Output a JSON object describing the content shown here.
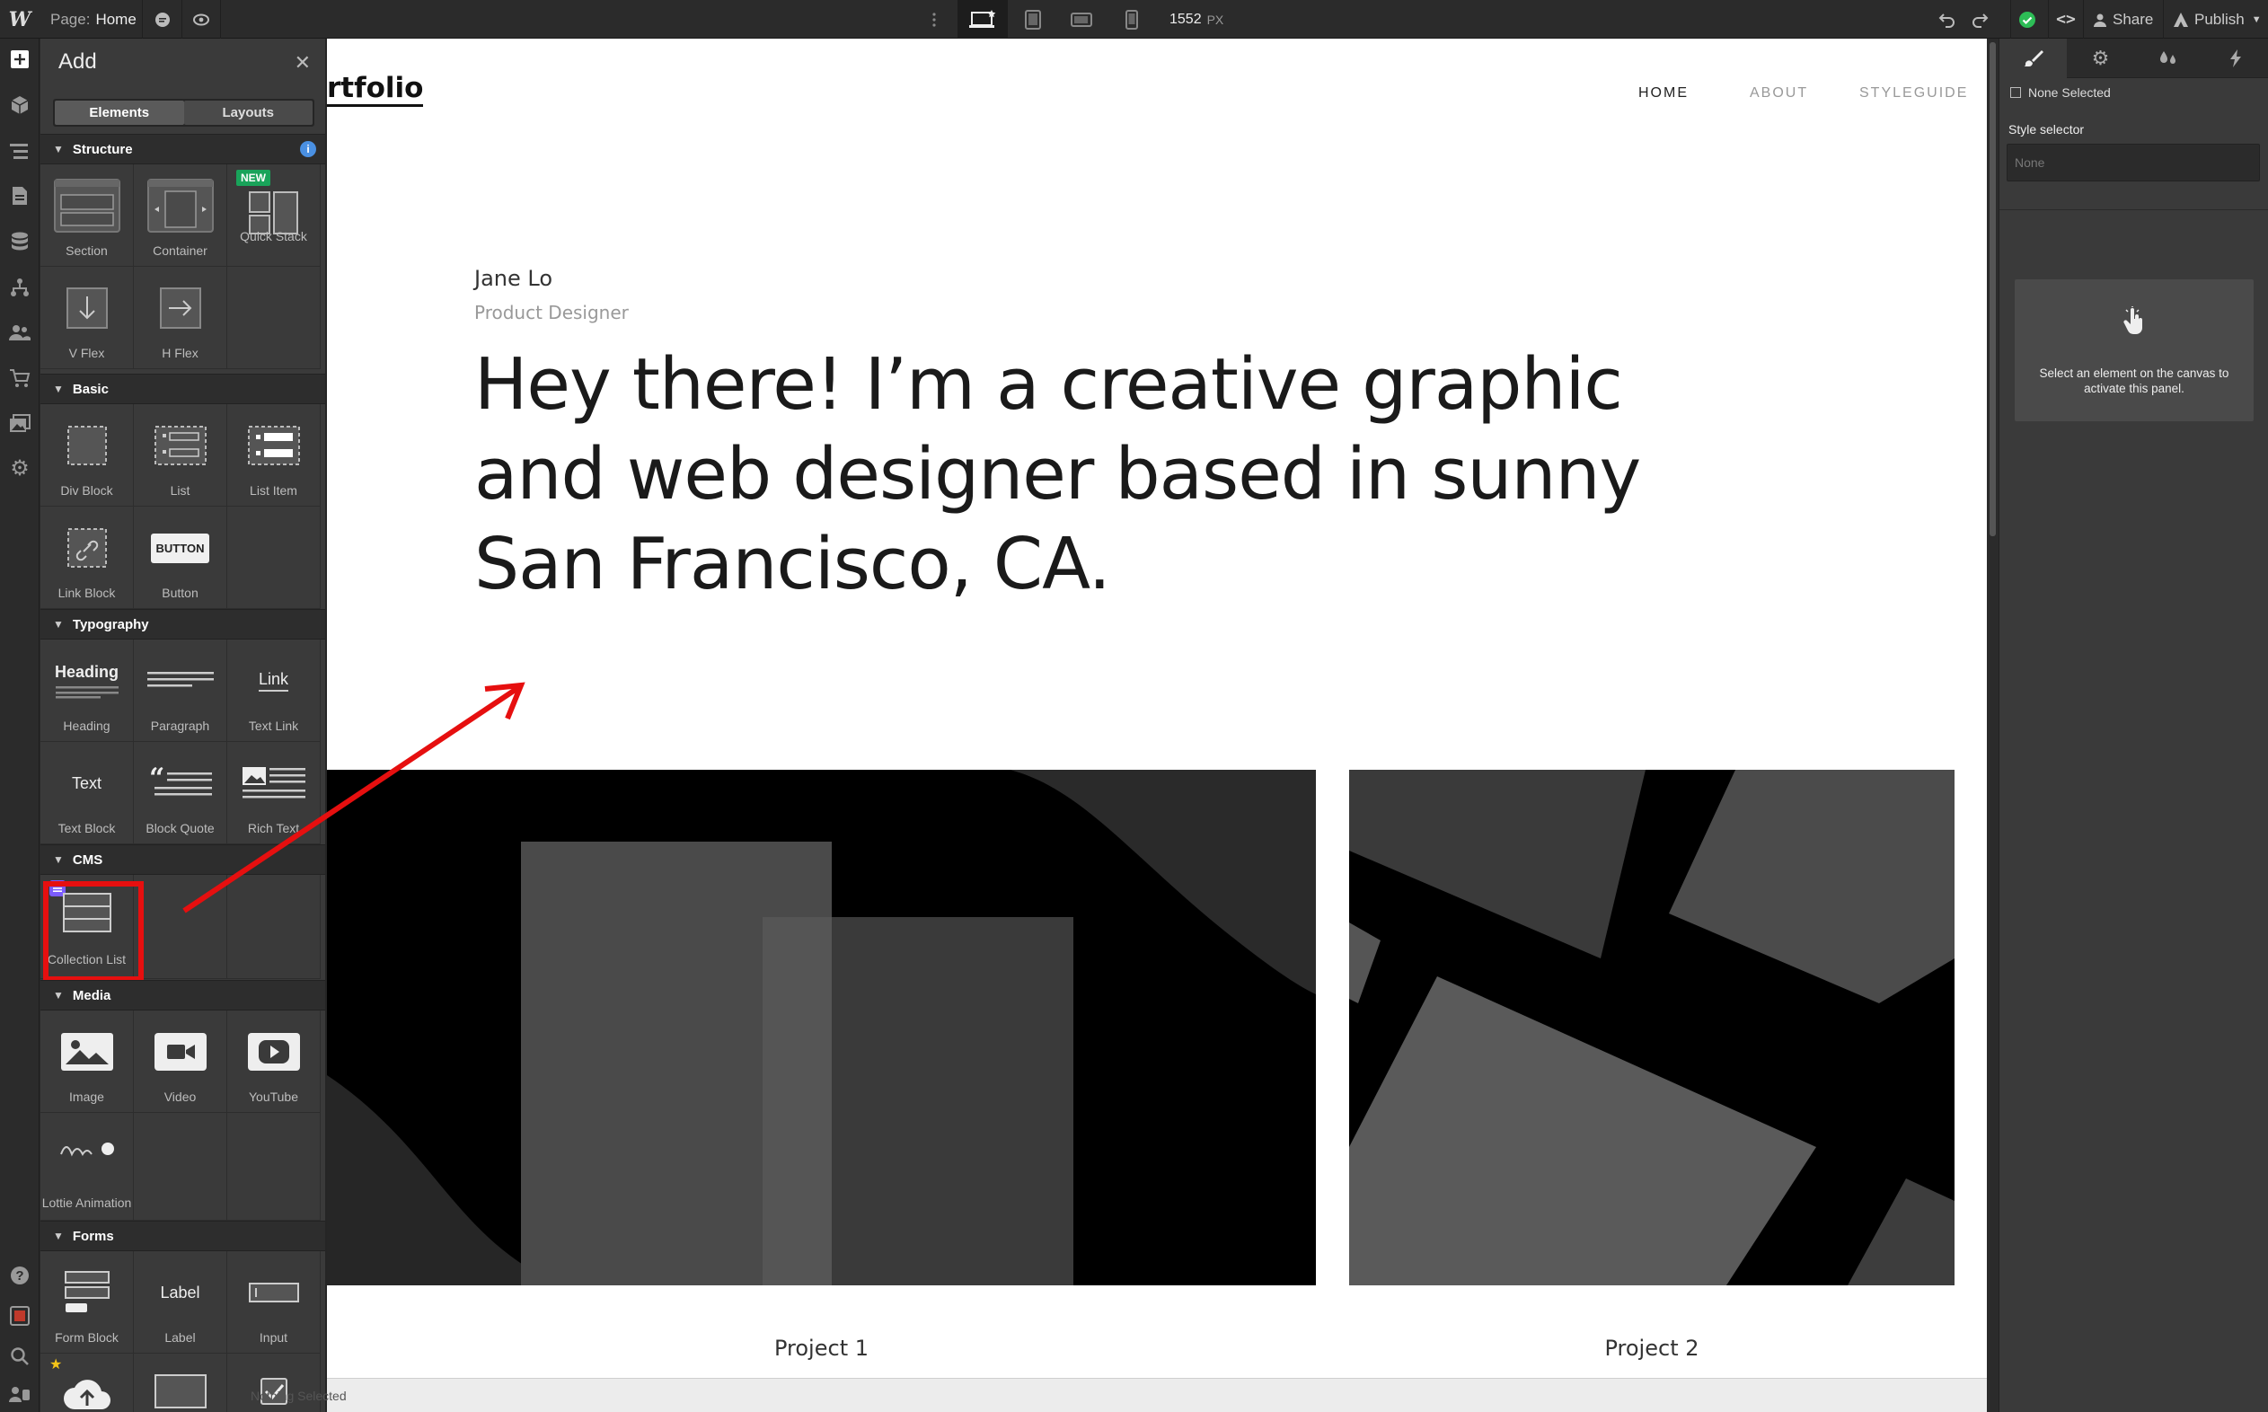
{
  "topbar": {
    "logo": "W",
    "page_label": "Page:",
    "page_name": "Home",
    "width_value": "1552",
    "width_unit": "PX",
    "share_label": "Share",
    "publish_label": "Publish"
  },
  "add_panel": {
    "title": "Add",
    "tabs": [
      "Elements",
      "Layouts"
    ],
    "sections": {
      "structure": "Structure",
      "basic": "Basic",
      "typography": "Typography",
      "cms": "CMS",
      "media": "Media",
      "forms": "Forms"
    },
    "new_badge": "NEW",
    "items": {
      "section": "Section",
      "container": "Container",
      "quick_stack": "Quick Stack",
      "v_flex": "V Flex",
      "h_flex": "H Flex",
      "div_block": "Div Block",
      "list": "List",
      "list_item": "List Item",
      "link_block": "Link Block",
      "button": "Button",
      "button_preview": "BUTTON",
      "heading": "Heading",
      "heading_preview": "Heading",
      "paragraph": "Paragraph",
      "text_link": "Text Link",
      "text_link_preview": "Link",
      "text_block": "Text Block",
      "text_block_preview": "Text",
      "block_quote": "Block Quote",
      "rich_text": "Rich Text",
      "collection_list": "Collection List",
      "image": "Image",
      "video": "Video",
      "youtube": "YouTube",
      "lottie": "Lottie Animation",
      "form_block": "Form Block",
      "label": "Label",
      "label_preview": "Label",
      "input": "Input"
    }
  },
  "canvas": {
    "brand": "Portfolio",
    "nav": [
      "HOME",
      "ABOUT",
      "STYLEGUIDE"
    ],
    "name": "Jane Lo",
    "role": "Product Designer",
    "headline": "Hey there! I’m a creative graphic and web designer based in sunny San Francisco, CA.",
    "projects": [
      "Project 1",
      "Project 2"
    ]
  },
  "status_bar": {
    "text": "Nothing Selected"
  },
  "right_panel": {
    "none_selected": "None Selected",
    "style_selector_label": "Style selector",
    "style_selector_placeholder": "None",
    "empty_message": "Select an element on the canvas to activate this panel."
  },
  "colors": {
    "accent_red": "#e60f0f",
    "new_badge": "#19a35a",
    "cms_badge": "#7b5cff",
    "check_green": "#2dbd56"
  }
}
